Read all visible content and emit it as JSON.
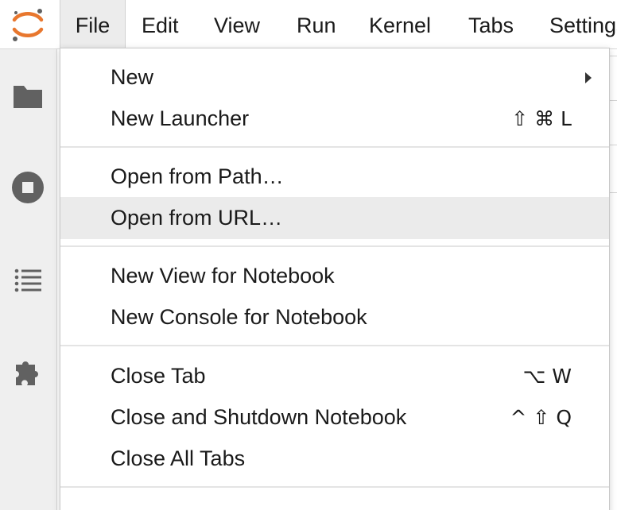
{
  "menubar": {
    "items": [
      {
        "label": "File"
      },
      {
        "label": "Edit"
      },
      {
        "label": "View"
      },
      {
        "label": "Run"
      },
      {
        "label": "Kernel"
      },
      {
        "label": "Tabs"
      },
      {
        "label": "Settings"
      }
    ],
    "active": "File"
  },
  "sidebar": {
    "icons": [
      "folder-icon",
      "running-stop-icon",
      "table-of-contents-icon",
      "extension-puzzle-icon"
    ]
  },
  "file_menu": {
    "groups": [
      [
        {
          "label": "New",
          "shortcut": "",
          "submenu": true
        },
        {
          "label": "New Launcher",
          "shortcut": "⇧ ⌘ L"
        }
      ],
      [
        {
          "label": "Open from Path…",
          "shortcut": ""
        },
        {
          "label": "Open from URL…",
          "shortcut": "",
          "highlighted": true
        }
      ],
      [
        {
          "label": "New View for Notebook",
          "shortcut": ""
        },
        {
          "label": "New Console for Notebook",
          "shortcut": ""
        }
      ],
      [
        {
          "label": "Close Tab",
          "shortcut": "⌥ W"
        },
        {
          "label": "Close and Shutdown Notebook",
          "shortcut": "^ ⇧ Q"
        },
        {
          "label": "Close All Tabs",
          "shortcut": ""
        }
      ]
    ]
  },
  "colors": {
    "logo_orange": "#e8772e",
    "logo_gray": "#616161",
    "icon_gray": "#616161",
    "highlight": "#ebebeb"
  }
}
